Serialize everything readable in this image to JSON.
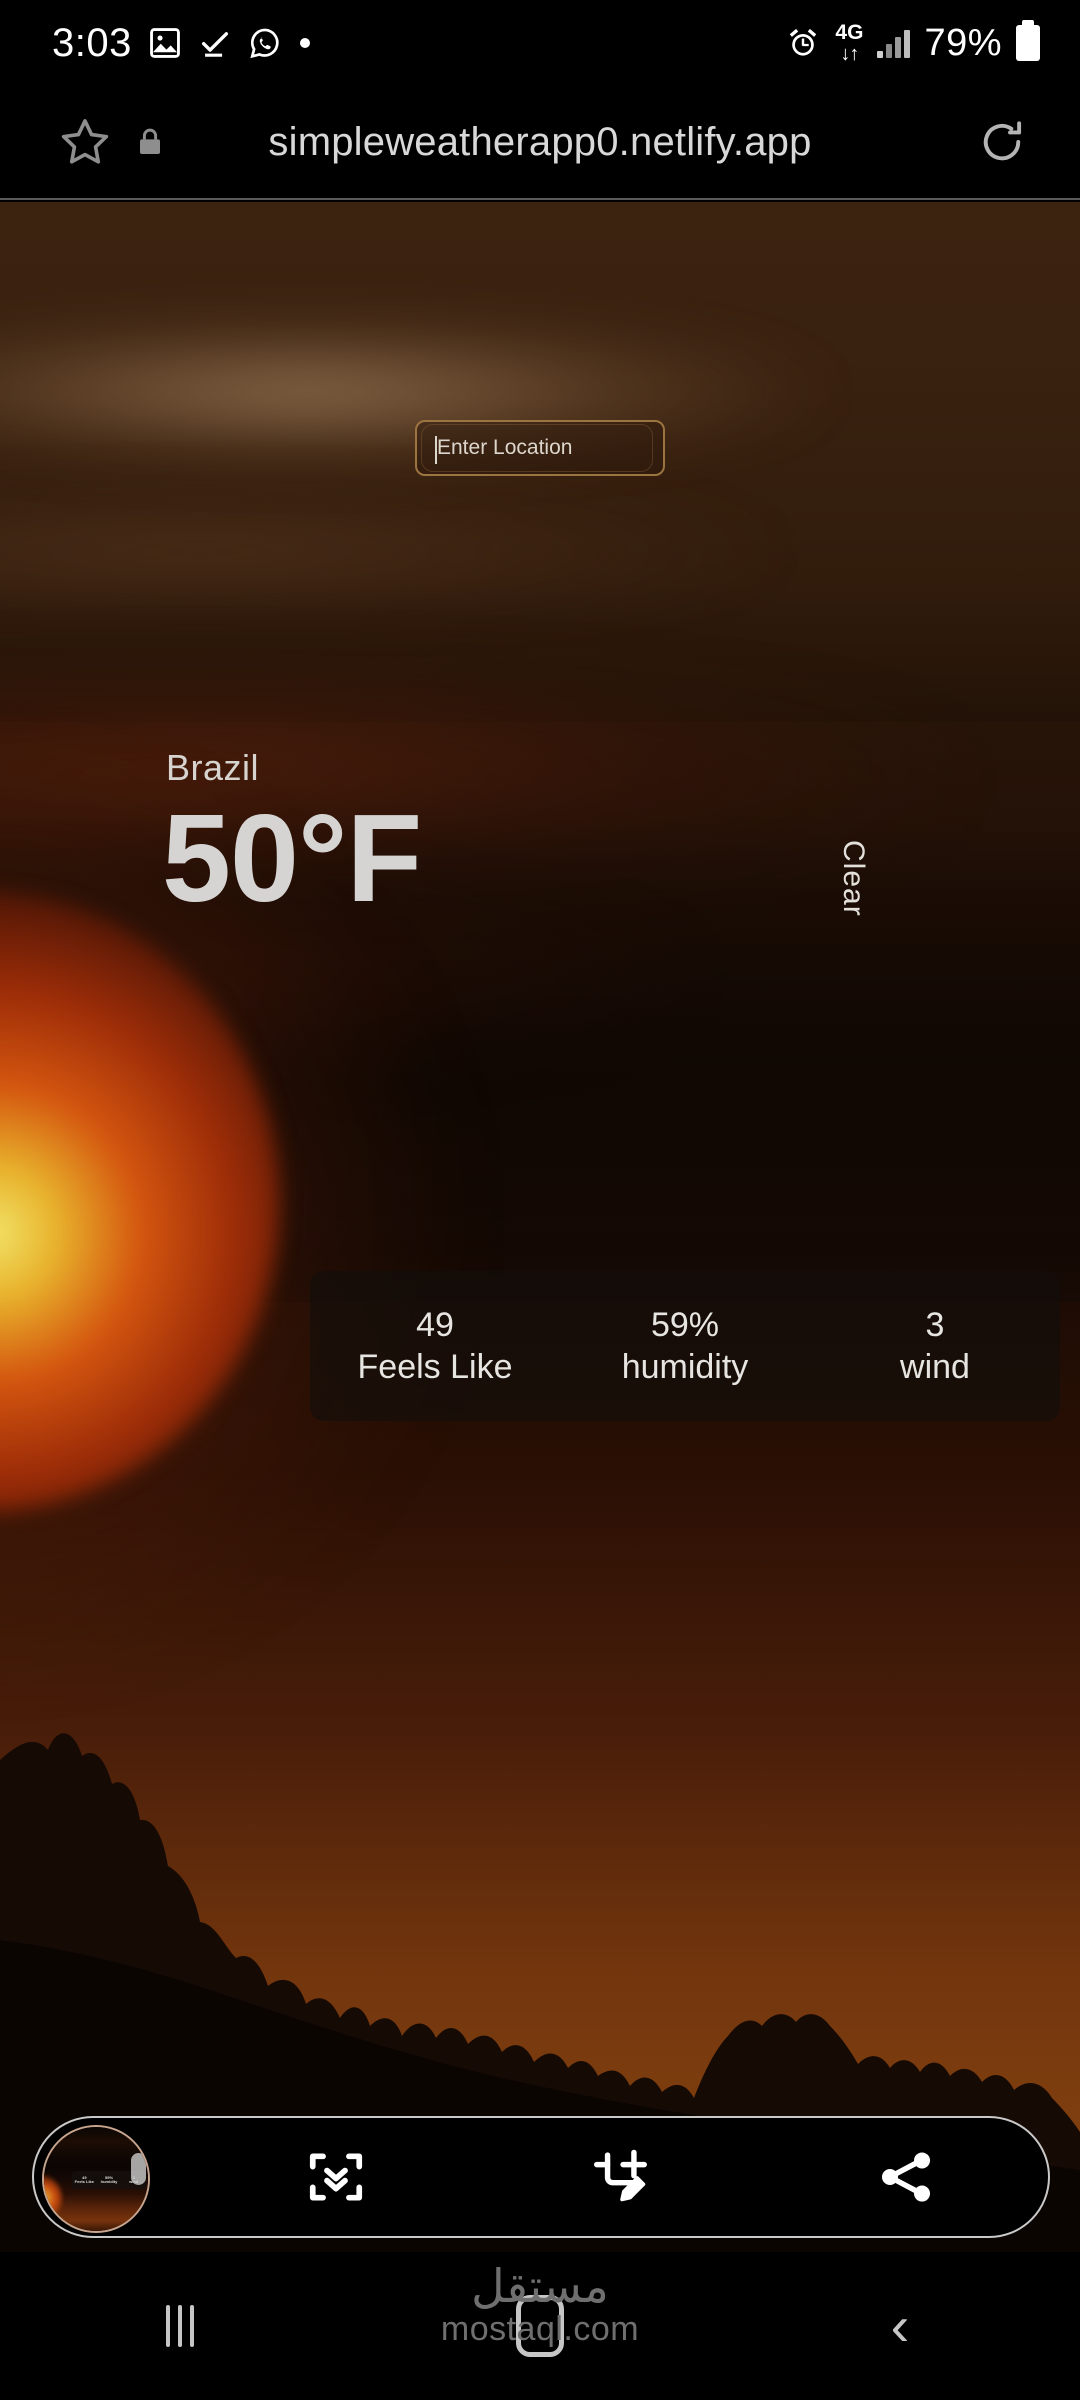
{
  "statusbar": {
    "time": "3:03",
    "left_icons": [
      "image-icon",
      "download-complete-icon",
      "whatsapp-icon",
      "dot-icon"
    ],
    "alarm_icon": "alarm-icon",
    "network_label": "4G",
    "network_arrows": "↓↑",
    "signal_icon": "signal-bars-icon",
    "battery_percent": "79%",
    "battery_icon": "battery-icon"
  },
  "browser": {
    "star_icon": "bookmark-star-icon",
    "lock_icon": "lock-icon",
    "url": "simpleweatherapp0.netlify.app",
    "reload_icon": "reload-icon"
  },
  "weather": {
    "search": {
      "placeholder": "Enter Location",
      "value": ""
    },
    "city": "Brazil",
    "temperature": "50°F",
    "condition": "Clear",
    "stats": [
      {
        "value": "49",
        "label": "Feels Like"
      },
      {
        "value": "59%",
        "label": "humidity"
      },
      {
        "value": "3",
        "label": "wind"
      }
    ]
  },
  "screenshot_toolbar": {
    "thumbnail_name": "screenshot-thumbnail",
    "thumb_mini_stats": [
      "49",
      "59%",
      "3"
    ],
    "thumb_mini_labels": [
      "Feels Like",
      "humidity",
      "wind"
    ],
    "buttons": [
      {
        "icon": "scroll-capture-icon",
        "label": "Scroll capture"
      },
      {
        "icon": "crop-edit-icon",
        "label": "Crop and edit"
      },
      {
        "icon": "share-icon",
        "label": "Share"
      }
    ]
  },
  "navbar": {
    "recents_icon": "recents-icon",
    "home_icon": "home-icon",
    "back_icon": "back-icon"
  },
  "watermark": {
    "arabic": "مستقل",
    "latin": "mostaql.com"
  },
  "colors": {
    "accent_border": "#9c7440",
    "text_light": "#d5d4d2",
    "panel_bg": "rgba(18,14,12,0.62)",
    "chrome_bg": "#000000"
  }
}
